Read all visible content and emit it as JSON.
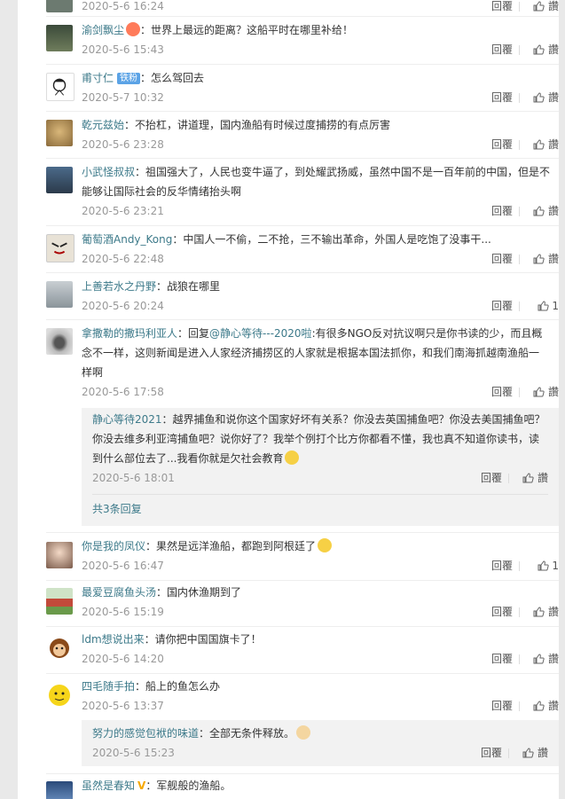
{
  "labels": {
    "reply": "回覆",
    "like": "讚"
  },
  "comments": [
    {
      "id": "c0",
      "user": "",
      "text": "",
      "time": "2020-5-6 16:24",
      "likes": ""
    },
    {
      "id": "c1",
      "user": "渝剑飘尘",
      "text": "：世界上最远的距离？这船平时在哪里补给！",
      "time": "2020-5-6 15:43",
      "likes": ""
    },
    {
      "id": "c2",
      "user": "甫寸仁",
      "badge": "铁粉",
      "text": "：怎么驾回去",
      "time": "2020-5-7 10:32",
      "likes": ""
    },
    {
      "id": "c3",
      "user": "乾元兹始",
      "text": "：不抬杠，讲道理，国内渔船有时候过度捕捞的有点厉害",
      "time": "2020-5-6 23:28",
      "likes": ""
    },
    {
      "id": "c4",
      "user": "小武怪叔叔",
      "text": "：祖国强大了，人民也变牛逼了，到处耀武扬威，虽然中国不是一百年前的中国，但是不能够让国际社会的反华情绪抬头啊",
      "time": "2020-5-6 23:21",
      "likes": ""
    },
    {
      "id": "c5",
      "user": "葡萄酒Andy_Kong",
      "text": "：中国人一不偷，二不抢，三不输出革命，外国人是吃饱了没事干...",
      "time": "2020-5-6 22:48",
      "likes": ""
    },
    {
      "id": "c6",
      "user": "上善若水之丹野",
      "text": "：战狼在哪里",
      "time": "2020-5-6 20:24",
      "likes": "1"
    },
    {
      "id": "c7",
      "user": "拿撒勒的撒玛利亚人",
      "text": "：回复",
      "mention": "@静心等待---2020啦",
      "text2": ":有很多NGO反对抗议啊只是你书读的少，而且概念不一样，这则新闻是进入人家经济捕捞区的人家就是根据本国法抓你，和我们南海抓越南渔船一样啊",
      "time": "2020-5-6 17:58",
      "likes": ""
    },
    {
      "id": "c8",
      "user": "你是我的凤仪",
      "text": "：果然是远洋渔船，都跑到阿根廷了",
      "time": "2020-5-6 16:47",
      "likes": "1"
    },
    {
      "id": "c9",
      "user": "最爱豆腐鱼头汤",
      "text": "：国内休渔期到了",
      "time": "2020-5-6 15:19",
      "likes": ""
    },
    {
      "id": "c10",
      "user": "ldm想说出来",
      "text": "：请你把中国国旗卡了！",
      "time": "2020-5-6 14:20",
      "likes": ""
    },
    {
      "id": "c11",
      "user": "四毛随手拍",
      "text": "：船上的鱼怎么办",
      "time": "2020-5-6 13:37",
      "likes": ""
    },
    {
      "id": "c12",
      "user": "虽然是春知",
      "text": "：军舰般的渔船。",
      "time": "",
      "likes": ""
    }
  ],
  "sub1": {
    "user": "静心等待2021",
    "text": "：越界捕鱼和说你这个国家好坏有关系？你没去英国捕鱼吧？你没去美国捕鱼吧？你没去维多利亚湾捕鱼吧？说你好了？我举个例打个比方你都看不懂，我也真不知道你读书，读到什么部位去了...我看你就是欠社会教育",
    "time": "2020-5-6 18:01",
    "more": "共3条回复"
  },
  "sub2": {
    "user": "努力的感觉包袱的味道",
    "text": "：全部无条件释放。",
    "time": "2020-5-6 15:23"
  },
  "colors": {
    "link": "#3d7a8a",
    "badge": "#5ba3e6",
    "time": "#999999"
  }
}
